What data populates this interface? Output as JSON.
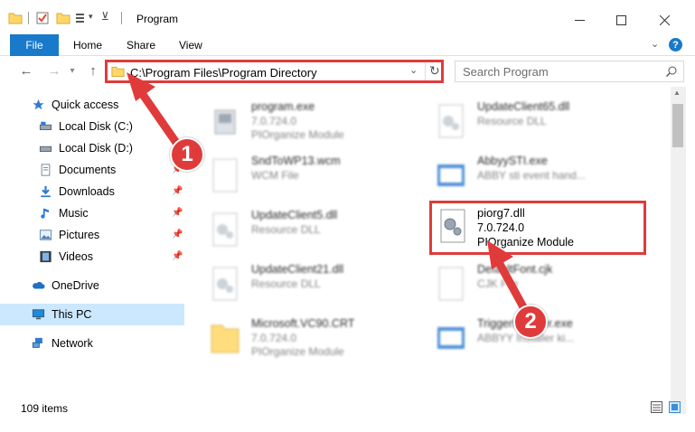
{
  "window": {
    "title": "Program",
    "minimize_icon": "minimize-icon",
    "maximize_icon": "maximize-icon",
    "close_icon": "close-icon"
  },
  "ribbon": {
    "tabs": [
      {
        "label": "File"
      },
      {
        "label": "Home"
      },
      {
        "label": "Share"
      },
      {
        "label": "View"
      }
    ],
    "help": "?",
    "accent": "#1979ca"
  },
  "address": {
    "path": "C:\\Program Files\\Program Directory",
    "search_placeholder": "Search Program"
  },
  "sidebar": {
    "items": [
      {
        "label": "Quick access",
        "icon": "star-icon"
      },
      {
        "label": "Local Disk (C:)",
        "icon": "drive-icon"
      },
      {
        "label": "Local Disk (D:)",
        "icon": "drive-icon"
      },
      {
        "label": "Documents",
        "icon": "documents-icon"
      },
      {
        "label": "Downloads",
        "icon": "downloads-icon"
      },
      {
        "label": "Music",
        "icon": "music-icon"
      },
      {
        "label": "Pictures",
        "icon": "pictures-icon"
      },
      {
        "label": "Videos",
        "icon": "videos-icon"
      },
      {
        "label": "OneDrive",
        "icon": "cloud-icon"
      },
      {
        "label": "This PC",
        "icon": "computer-icon"
      },
      {
        "label": "Network",
        "icon": "network-icon"
      }
    ]
  },
  "files": [
    {
      "name": "program.exe",
      "ver": "7.0.724.0",
      "type": "PIOrganize Module"
    },
    {
      "name": "UpdateClient65.dll",
      "ver": "Resource DLL",
      "type": ""
    },
    {
      "name": "SndToWP13.wcm",
      "ver": "WCM File",
      "type": ""
    },
    {
      "name": "AbbyySTI.exe",
      "ver": "ABBY sti event hand...",
      "type": ""
    },
    {
      "name": "UpdateClient5.dll",
      "ver": "Resource DLL",
      "type": ""
    },
    {
      "name": "piorg7.dll",
      "ver": "7.0.724.0",
      "type": "PIOrganize Module"
    },
    {
      "name": "UpdateClient21.dll",
      "ver": "Resource DLL",
      "type": ""
    },
    {
      "name": "DefaultFont.cjk",
      "ver": "CJK File",
      "type": ""
    },
    {
      "name": "Microsoft.VC90.CRT",
      "ver": "7.0.724.0",
      "type": "PIOrganize Module"
    },
    {
      "name": "TriggerInstaller.exe",
      "ver": "ABBYY Installer ki...",
      "type": ""
    }
  ],
  "status": {
    "count": "109 items"
  },
  "annotations": {
    "first": "1",
    "second": "2",
    "color": "#e03b3b"
  }
}
